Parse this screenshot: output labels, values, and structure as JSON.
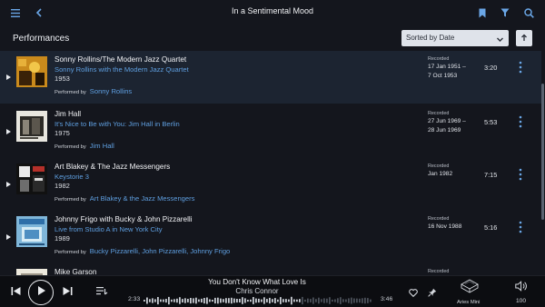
{
  "header": {
    "title": "In a Sentimental Mood"
  },
  "section": {
    "title": "Performances"
  },
  "sort": {
    "selected": "Sorted by Date"
  },
  "performances": [
    {
      "artist": "Sonny Rollins/The Modern Jazz Quartet",
      "album": "Sonny Rollins with the Modern Jazz Quartet",
      "year": "1953",
      "performed_by_label": "Performed by",
      "performers": "Sonny Rollins",
      "recorded_label": "Recorded",
      "recorded_line1": "17 Jan 1951 –",
      "recorded_line2": "7 Oct 1953",
      "duration": "3:20"
    },
    {
      "artist": "Jim Hall",
      "album": "It's Nice to Be with You: Jim Hall in Berlin",
      "year": "1975",
      "performed_by_label": "Performed by",
      "performers": "Jim Hall",
      "recorded_label": "Recorded",
      "recorded_line1": "27 Jun 1969 –",
      "recorded_line2": "28 Jun 1969",
      "duration": "5:53"
    },
    {
      "artist": "Art Blakey & The Jazz Messengers",
      "album": "Keystorie 3",
      "year": "1982",
      "performed_by_label": "Performed by",
      "performers": "Art Blakey & the Jazz Messengers",
      "recorded_label": "Recorded",
      "recorded_line1": "Jan 1982",
      "recorded_line2": "",
      "duration": "7:15"
    },
    {
      "artist": "Johnny Frigo with Bucky & John Pizzarelli",
      "album": "Live from Studio A in New York City",
      "year": "1989",
      "performed_by_label": "Performed by",
      "performers": "Bucky Pizzarelli, John Pizzarelli, Johnny Frigo",
      "recorded_label": "Recorded",
      "recorded_line1": "16 Nov 1988",
      "recorded_line2": "",
      "duration": "5:16"
    },
    {
      "artist": "Mike Garson",
      "album": "",
      "year": "",
      "performed_by_label": "",
      "performers": "",
      "recorded_label": "Recorded",
      "recorded_line1": "",
      "recorded_line2": "",
      "duration": ""
    }
  ],
  "player": {
    "track_title": "You Don't Know What Love Is",
    "track_artist": "Chris Connor",
    "elapsed": "2:33",
    "total": "3:46",
    "progress_fraction": 0.68,
    "device": "Aries Mini",
    "volume": "100"
  },
  "colors": {
    "accent": "#5f9fe0",
    "background": "#14161d",
    "selected_row": "#1c2431"
  }
}
